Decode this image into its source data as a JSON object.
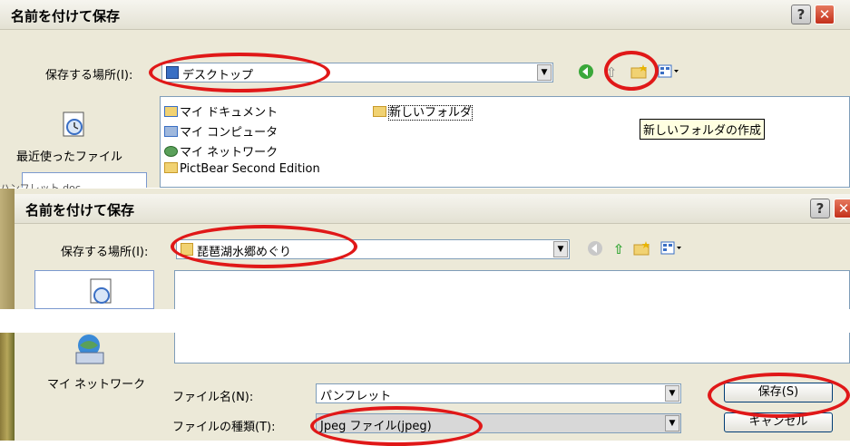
{
  "top_dialog": {
    "title": "名前を付けて保存",
    "help_symbol": "?",
    "close_symbol": "✕",
    "location_label": "保存する場所(I):",
    "location_value": "デスクトップ",
    "files": [
      "マイ ドキュメント",
      "マイ コンピュータ",
      "マイ ネットワーク",
      "PictBear Second Edition",
      "新しいフォルダ"
    ],
    "recent_label": "最近使ったファイル",
    "tooltip": "新しいフォルダの作成",
    "partial_text": "ハンフレット.doc"
  },
  "bottom_dialog": {
    "title": "名前を付けて保存",
    "help_symbol": "?",
    "close_symbol": "✕",
    "location_label": "保存する場所(I):",
    "location_value": "琵琶湖水郷めぐり",
    "network_label": "マイ ネットワーク",
    "filename_label": "ファイル名(N):",
    "filename_value": "パンフレット",
    "filetype_label": "ファイルの種類(T):",
    "filetype_value": "Jpeg ファイル(jpeg)",
    "save_button": "保存(S)",
    "cancel_button": "キャンセル"
  },
  "accent_colors": {
    "highlight_oval": "#e01818",
    "xp_close": "#c3301a",
    "places_bar": "#7b99cf"
  }
}
